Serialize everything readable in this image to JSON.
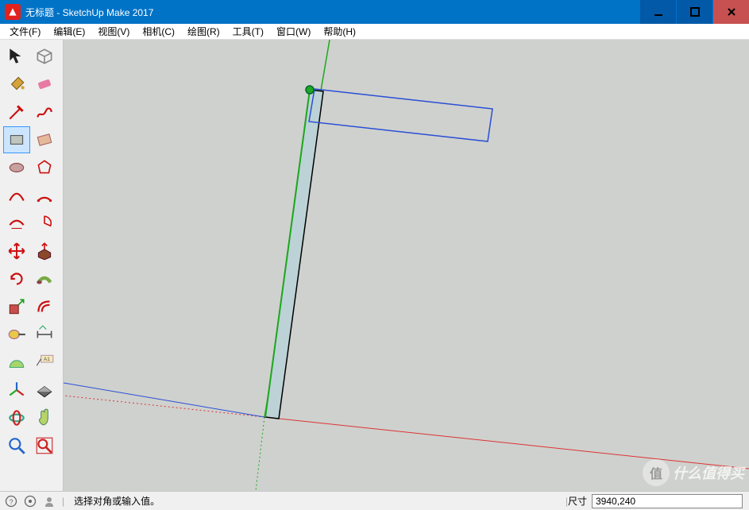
{
  "window": {
    "title": "无标题 - SketchUp Make 2017"
  },
  "menu": {
    "file": "文件(F)",
    "edit": "编辑(E)",
    "view": "视图(V)",
    "camera": "相机(C)",
    "draw": "绘图(R)",
    "tools": "工具(T)",
    "window": "窗口(W)",
    "help": "帮助(H)"
  },
  "tools": {
    "select": "select-tool",
    "component": "component-tool",
    "paint": "paint-bucket-tool",
    "eraser": "eraser-tool",
    "line": "line-tool",
    "freehand": "freehand-tool",
    "rectangle": "rectangle-tool",
    "rotated_rectangle": "rotated-rectangle-tool",
    "circle": "circle-tool",
    "polygon": "polygon-tool",
    "arc": "arc-tool",
    "arc2": "two-point-arc-tool",
    "arc3": "three-point-arc-tool",
    "pie": "pie-tool",
    "move": "move-tool",
    "pushpull": "push-pull-tool",
    "rotate": "rotate-tool",
    "followme": "follow-me-tool",
    "scale": "scale-tool",
    "offset": "offset-tool",
    "tape": "tape-measure-tool",
    "dimension": "dimension-tool",
    "protractor": "protractor-tool",
    "text": "text-tool",
    "axes": "axes-tool",
    "section": "section-plane-tool",
    "orbit": "orbit-tool",
    "pan": "pan-tool",
    "zoom": "zoom-tool",
    "zoom_extents": "zoom-extents-tool"
  },
  "status": {
    "message": "选择对角或输入值。",
    "dim_label": "尺寸",
    "dim_value": "3940,240",
    "separator": "|"
  },
  "watermark": {
    "circle": "值",
    "text": "什么值得买"
  }
}
